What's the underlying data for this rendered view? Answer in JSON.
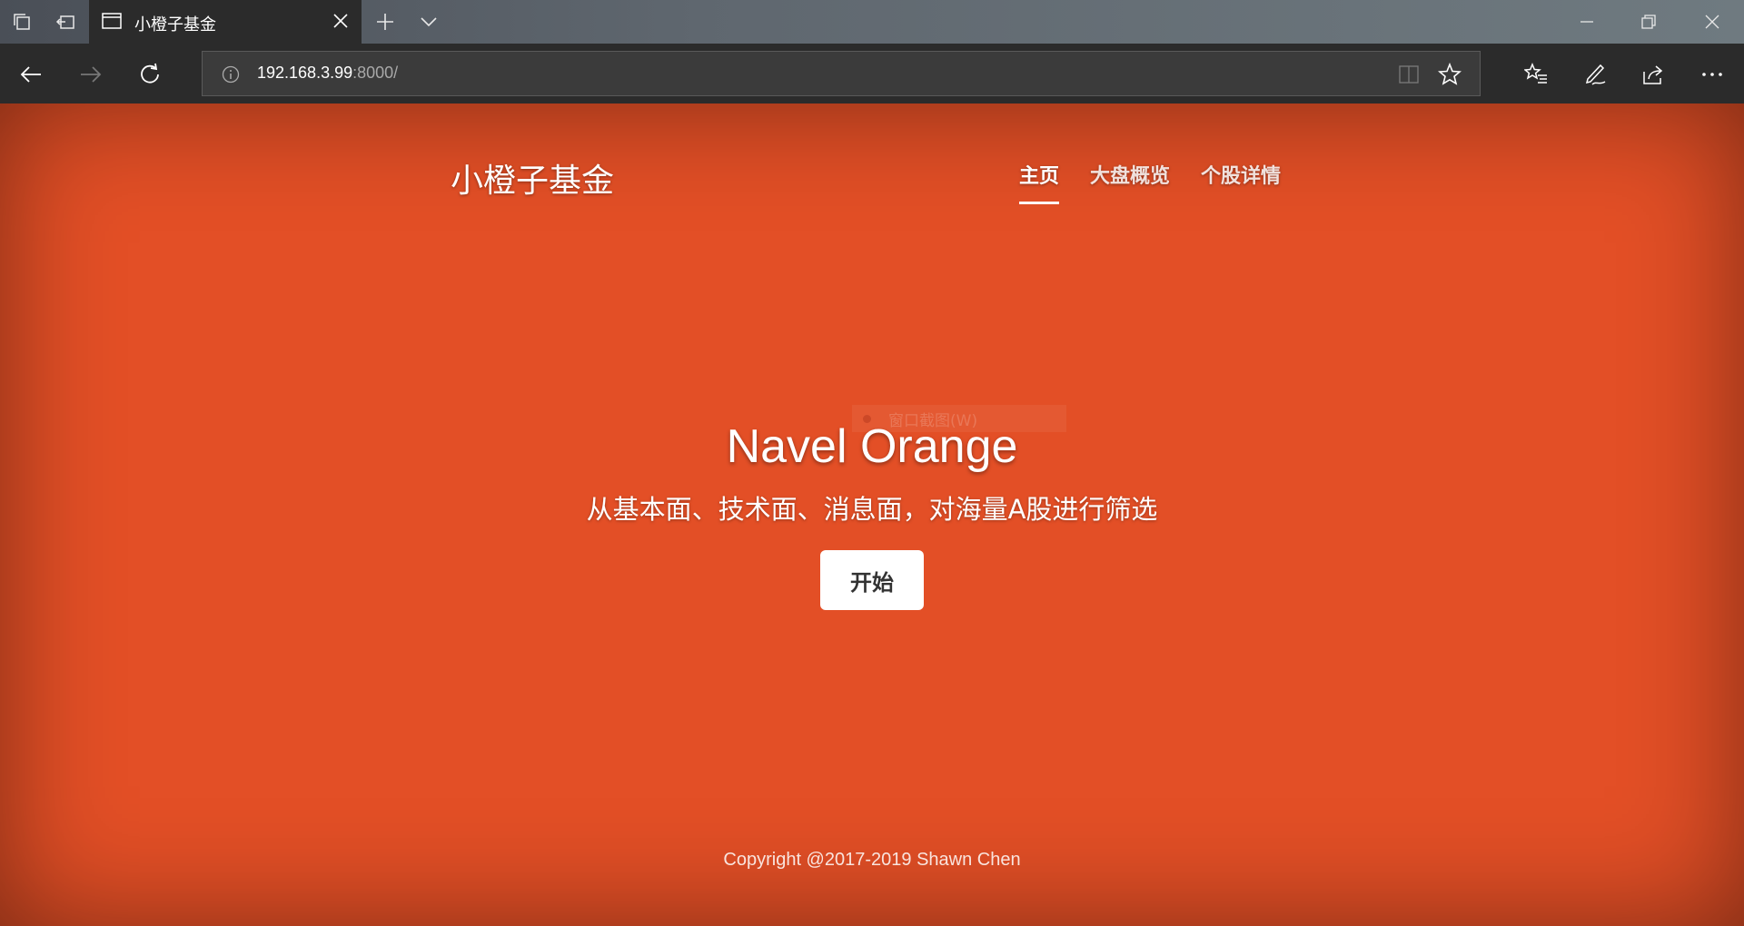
{
  "browser": {
    "tab_title": "小橙子基金",
    "url_host": "192.168.3.99",
    "url_rest": ":8000/"
  },
  "site": {
    "brand": "小橙子基金",
    "nav": [
      {
        "label": "主页",
        "active": true
      },
      {
        "label": "大盘概览",
        "active": false
      },
      {
        "label": "个股详情",
        "active": false
      }
    ],
    "hero_title": "Navel Orange",
    "hero_subtitle": "从基本面、技术面、消息面，对海量A股进行筛选",
    "start_label": "开始",
    "ghost_tooltip": "窗口截图(W)",
    "footer": "Copyright @2017-2019 Shawn Chen"
  },
  "colors": {
    "page_bg": "#e34f26",
    "chrome_bg": "#2b2b2b"
  }
}
